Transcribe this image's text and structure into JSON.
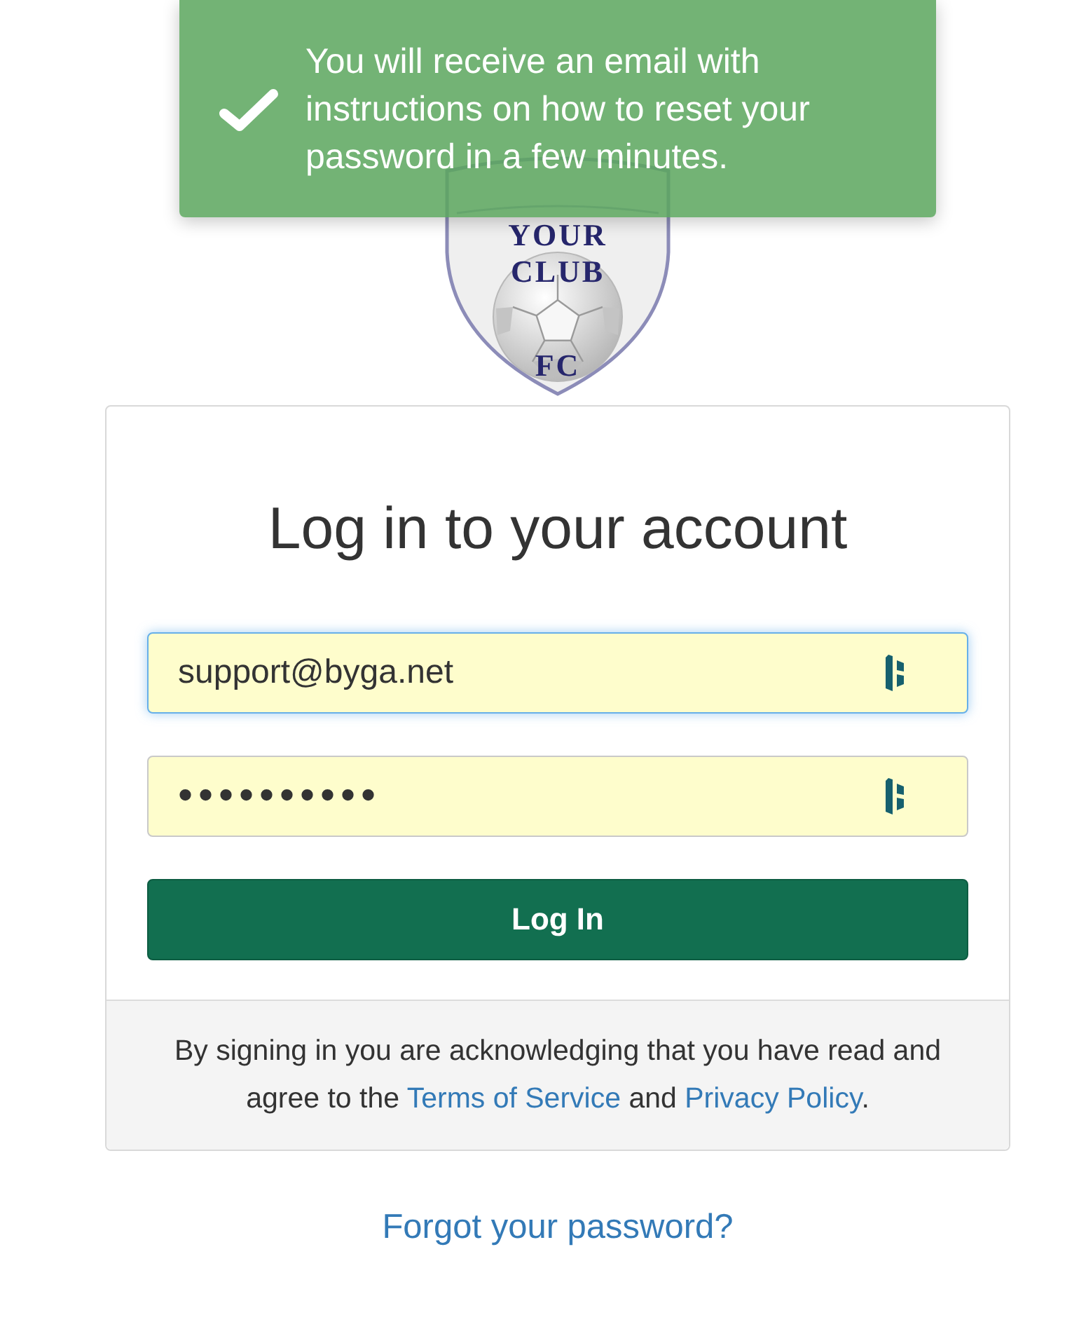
{
  "toast": {
    "kind": "success",
    "message": "You will receive an email with instructions on how to reset your password in a few minutes."
  },
  "logo": {
    "lines": [
      "YOUR",
      "CLUB",
      "FC"
    ]
  },
  "login_card": {
    "title": "Log in to your account",
    "fields": [
      {
        "kind": "email",
        "value": "support@byga.net",
        "focused": true
      },
      {
        "kind": "password",
        "value": "••••••••••",
        "focused": false
      }
    ],
    "submit_button": "Log In",
    "terms": [
      {
        "kind": "text",
        "text": "By signing in you are acknowledging that you have read and agree to the "
      },
      {
        "kind": "link",
        "text": "Terms of Service"
      },
      {
        "kind": "text",
        "text": " and "
      },
      {
        "kind": "link",
        "text": "Privacy Policy"
      },
      {
        "kind": "text",
        "text": "."
      }
    ]
  },
  "forgot_password_link": "Forgot your password?"
}
